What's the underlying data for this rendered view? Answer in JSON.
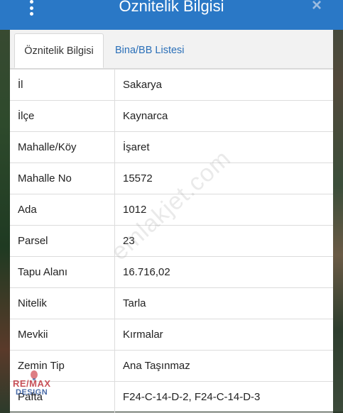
{
  "header": {
    "title": "Öznitelik Bilgisi",
    "close_label": "×"
  },
  "tabs": [
    {
      "label": "Öznitelik Bilgisi",
      "active": true
    },
    {
      "label": "Bina/BB Listesi",
      "active": false
    }
  ],
  "rows": [
    {
      "key": "İl",
      "value": "Sakarya"
    },
    {
      "key": "İlçe",
      "value": "Kaynarca"
    },
    {
      "key": "Mahalle/Köy",
      "value": "İşaret"
    },
    {
      "key": "Mahalle No",
      "value": "15572"
    },
    {
      "key": "Ada",
      "value": "1012"
    },
    {
      "key": "Parsel",
      "value": "23"
    },
    {
      "key": "Tapu Alanı",
      "value": "16.716,02"
    },
    {
      "key": "Nitelik",
      "value": "Tarla"
    },
    {
      "key": "Mevkii",
      "value": "Kırmalar"
    },
    {
      "key": "Zemin Tip",
      "value": "Ana Taşınmaz"
    },
    {
      "key": "Pafta",
      "value": "F24-C-14-D-2, F24-C-14-D-3"
    }
  ],
  "watermark": "emlakjet.com",
  "logo": {
    "line1": "RE/MAX",
    "line2": "DESIGN"
  },
  "colors": {
    "header": "#2a78c6",
    "tab_link": "#2a6fb8"
  }
}
